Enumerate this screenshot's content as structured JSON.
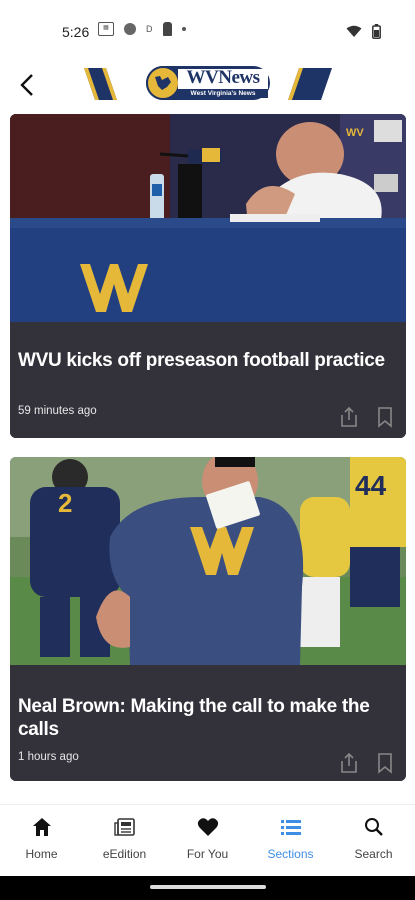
{
  "status": {
    "time": "5:26"
  },
  "header": {
    "logo_title": "WVNews",
    "logo_tagline": "West Virginia's News"
  },
  "articles": [
    {
      "headline": "WVU kicks off preseason football practice",
      "time": "59 minutes ago",
      "image_letter": "W"
    },
    {
      "headline": "Neal Brown: Making the call to make the calls",
      "time": "1 hours ago",
      "image_number": "44"
    }
  ],
  "nav": [
    {
      "label": "Home",
      "icon": "home-icon",
      "active": false
    },
    {
      "label": "eEdition",
      "icon": "newspaper-icon",
      "active": false
    },
    {
      "label": "For You",
      "icon": "heart-icon",
      "active": false
    },
    {
      "label": "Sections",
      "icon": "list-icon",
      "active": true
    },
    {
      "label": "Search",
      "icon": "search-icon",
      "active": false
    }
  ],
  "colors": {
    "accent": "#3f8ee6",
    "card_bg": "#33323b",
    "wvu_gold": "#e5b83a",
    "wvu_navy": "#1f3466"
  }
}
